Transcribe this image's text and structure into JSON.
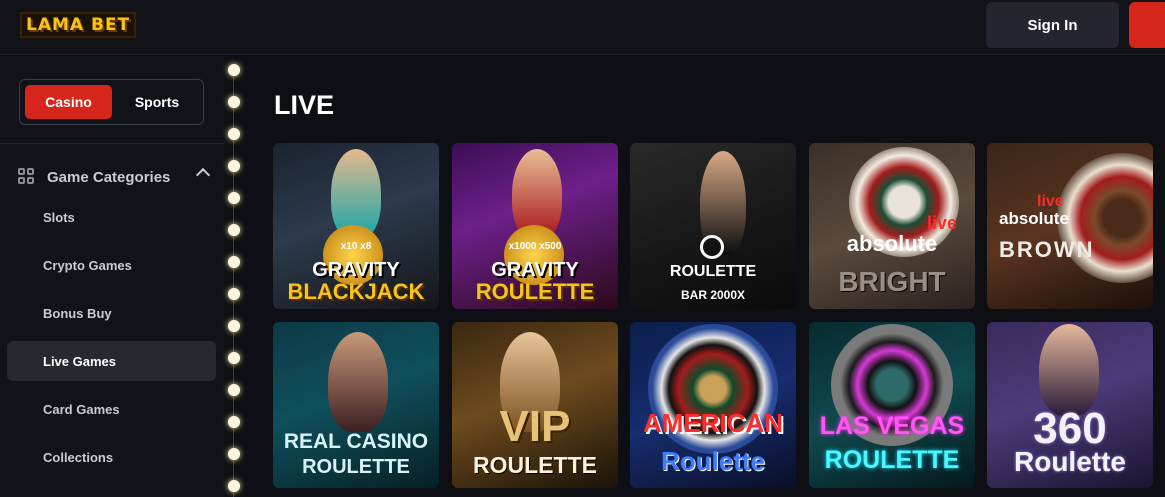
{
  "header": {
    "logo": "LAMA BET",
    "signin_label": "Sign In"
  },
  "sidebar": {
    "toggle": {
      "casino": "Casino",
      "sports": "Sports"
    },
    "categories_title": "Game Categories",
    "items": [
      {
        "label": "Slots"
      },
      {
        "label": "Crypto Games"
      },
      {
        "label": "Bonus Buy"
      },
      {
        "label": "Live Games"
      },
      {
        "label": "Card Games"
      },
      {
        "label": "Collections"
      }
    ]
  },
  "main": {
    "section_title": "LIVE",
    "games": [
      {
        "line1": "GRAVITY",
        "line2": "BLACKJACK",
        "badge": "x10  x8"
      },
      {
        "line1": "GRAVITY",
        "line2": "ROULETTE",
        "badge": "x1000  x500"
      },
      {
        "line1": "ROULETTE",
        "line2": "BAR 2000X"
      },
      {
        "line1": "live",
        "line2": "BRIGHT",
        "brand": "absolute"
      },
      {
        "line1": "live",
        "line2": "BROWN",
        "brand": "absolute"
      },
      {
        "line1": "REAL CASINO",
        "line2": "ROULETTE"
      },
      {
        "line1": "VIP",
        "line2": "ROULETTE"
      },
      {
        "line1": "AMERICAN",
        "line2": "Roulette"
      },
      {
        "line1": "LAS VEGAS",
        "line2": "ROULETTE"
      },
      {
        "line1": "360",
        "line2": "Roulette"
      }
    ]
  }
}
